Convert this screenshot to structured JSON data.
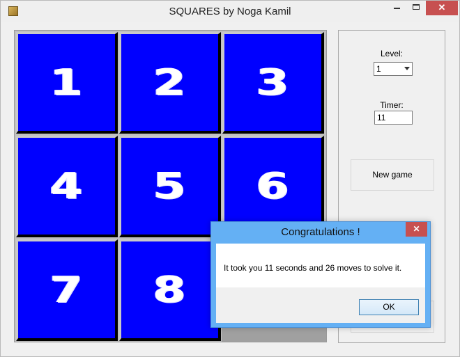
{
  "window": {
    "title": "SQUARES by Noga Kamil",
    "controls": {
      "minimize": "—",
      "maximize": "□",
      "close": "✕"
    }
  },
  "board": {
    "tiles": [
      "1",
      "2",
      "3",
      "4",
      "5",
      "6",
      "7",
      "8"
    ],
    "tile_color": "#0000ff",
    "empty_color": "#a0a0a0"
  },
  "side_panel": {
    "level_label": "Level:",
    "level_value": "1",
    "timer_label": "Timer:",
    "timer_value": "11",
    "new_game_label": "New game"
  },
  "dialog": {
    "title": "Congratulations !",
    "close": "✕",
    "message": "It took you 11 seconds and 26 moves to solve it.",
    "ok_label": "OK"
  }
}
